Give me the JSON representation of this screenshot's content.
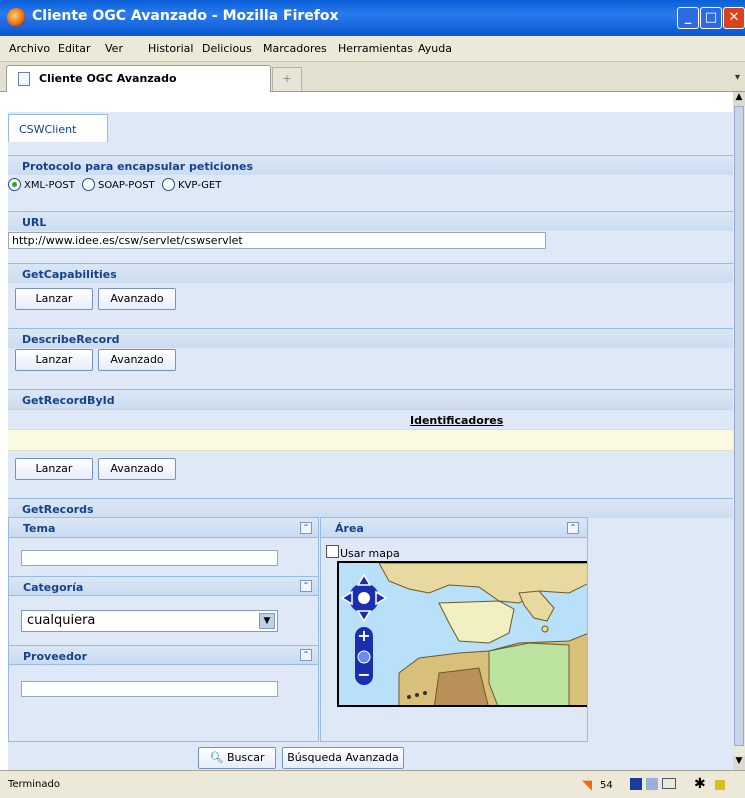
{
  "window": {
    "title": "Cliente OGC Avanzado - Mozilla Firefox"
  },
  "menu": [
    "Archivo",
    "Editar",
    "Ver",
    "Historial",
    "Delicious",
    "Marcadores",
    "Herramientas",
    "Ayuda"
  ],
  "tab": {
    "title": "Cliente OGC Avanzado",
    "new_tab": "+"
  },
  "client": {
    "tab_label": "CSWClient",
    "protocol": {
      "title": "Protocolo para encapsular peticiones",
      "options": [
        "XML-POST",
        "SOAP-POST",
        "KVP-GET"
      ],
      "selected": "XML-POST"
    },
    "url": {
      "title": "URL",
      "value": "http://www.idee.es/csw/servlet/cswservlet"
    },
    "getcapabilities": {
      "title": "GetCapabilities",
      "launch": "Lanzar",
      "advanced": "Avanzado"
    },
    "describerecord": {
      "title": "DescribeRecord",
      "launch": "Lanzar",
      "advanced": "Avanzado"
    },
    "getrecordbyid": {
      "title": "GetRecordById",
      "ids_header": "Identificadores",
      "launch": "Lanzar",
      "advanced": "Avanzado"
    },
    "getrecords": {
      "title": "GetRecords",
      "tema": {
        "title": "Tema",
        "value": ""
      },
      "categoria": {
        "title": "Categoría",
        "selected": "cualquiera"
      },
      "proveedor": {
        "title": "Proveedor",
        "value": ""
      },
      "area": {
        "title": "Área",
        "use_map": "Usar mapa"
      },
      "search": "Buscar",
      "advanced_search": "Búsqueda Avanzada"
    }
  },
  "status": {
    "text": "Terminado",
    "feed_count": "54"
  },
  "colors": {
    "header_text": "#15428B",
    "panel_bg": "#DFE8F6",
    "border": "#99BBE8"
  }
}
